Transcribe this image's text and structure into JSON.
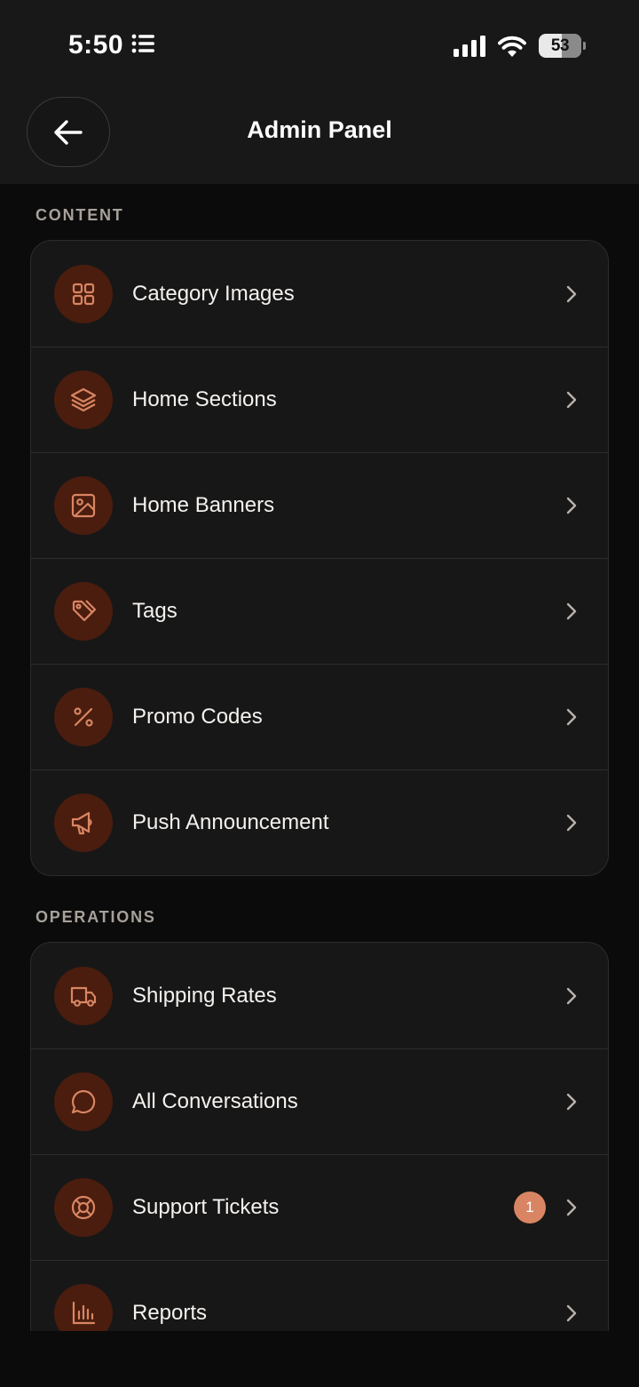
{
  "status_bar": {
    "time": "5:50",
    "battery": "53"
  },
  "header": {
    "title": "Admin Panel"
  },
  "sections": [
    {
      "label": "CONTENT",
      "items": [
        {
          "label": "Category Images",
          "icon": "grid-icon"
        },
        {
          "label": "Home Sections",
          "icon": "layers-icon"
        },
        {
          "label": "Home Banners",
          "icon": "image-icon"
        },
        {
          "label": "Tags",
          "icon": "tag-icon"
        },
        {
          "label": "Promo Codes",
          "icon": "percent-icon"
        },
        {
          "label": "Push Announcement",
          "icon": "megaphone-icon"
        }
      ]
    },
    {
      "label": "OPERATIONS",
      "items": [
        {
          "label": "Shipping Rates",
          "icon": "truck-icon"
        },
        {
          "label": "All Conversations",
          "icon": "chat-bubble-icon"
        },
        {
          "label": "Support Tickets",
          "icon": "lifebuoy-icon",
          "badge": "1"
        },
        {
          "label": "Reports",
          "icon": "bar-chart-icon"
        }
      ]
    }
  ],
  "colors": {
    "accent": "#d98563",
    "icon_bg": "#4a1d0e",
    "card_bg": "#171717",
    "background": "#0b0b0b"
  }
}
